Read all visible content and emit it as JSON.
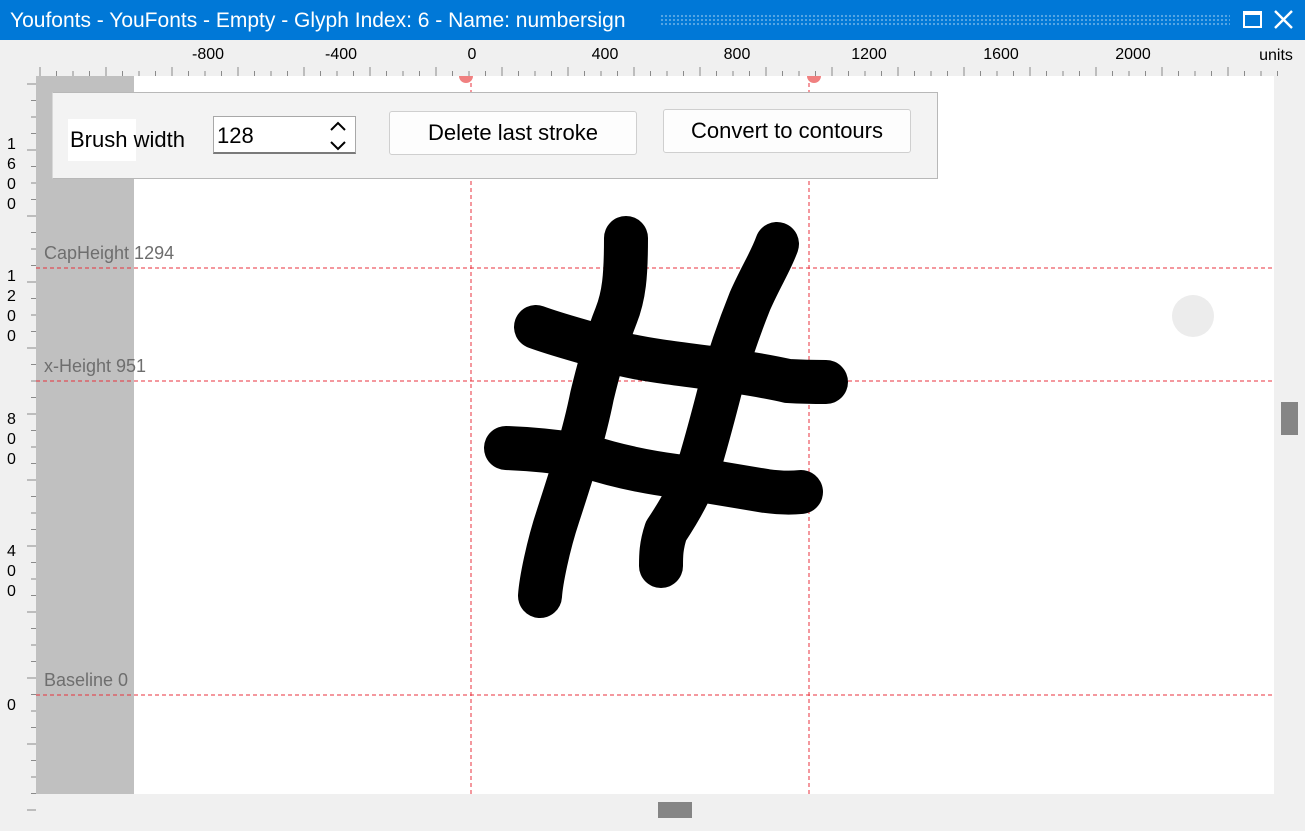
{
  "window": {
    "title": "Youfonts - YouFonts - Empty - Glyph Index: 6 - Name: numbersign",
    "accent_color": "#0078d7",
    "maximize_icon": "maximize-icon",
    "close_icon": "close-icon"
  },
  "ruler": {
    "units_label": "units",
    "horizontal_ticks": [
      "-800",
      "-400",
      "0",
      "400",
      "800",
      "1200",
      "1600",
      "2000"
    ],
    "vertical_ticks": [
      "1600",
      "1200",
      "800",
      "400",
      "0"
    ]
  },
  "guides": {
    "cap_height": "CapHeight 1294",
    "x_height": "x-Height 951",
    "baseline": "Baseline 0",
    "line_color": "#e8323c"
  },
  "toolbar": {
    "brush_width_label": "Brush width",
    "brush_width_value": "128",
    "delete_label": "Delete last stroke",
    "convert_label": "Convert to contours"
  },
  "glyph": {
    "name": "numbersign",
    "stroke_color": "#000000"
  }
}
